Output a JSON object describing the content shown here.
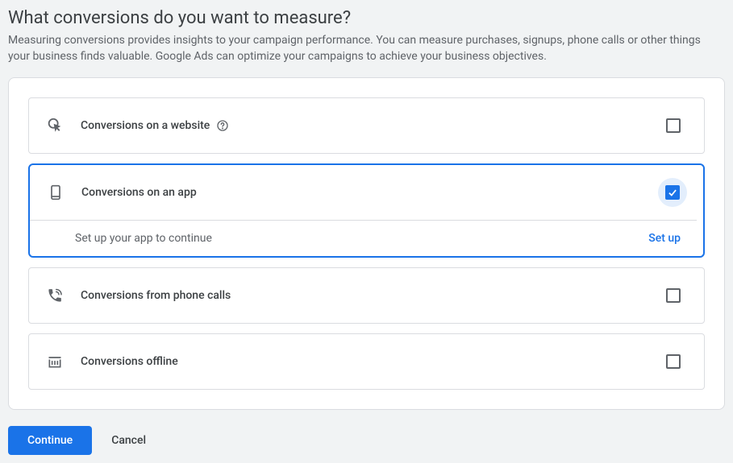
{
  "header": {
    "title": "What conversions do you want to measure?",
    "subtitle": "Measuring conversions provides insights to your campaign performance. You can measure purchases, signups, phone calls or other things your business finds valuable. Google Ads can optimize your campaigns to achieve your business objectives."
  },
  "options": {
    "website": {
      "label": "Conversions on a website"
    },
    "app": {
      "label": "Conversions on an app",
      "body": "Set up your app to continue",
      "action": "Set up"
    },
    "phone": {
      "label": "Conversions from phone calls"
    },
    "offline": {
      "label": "Conversions offline"
    }
  },
  "actions": {
    "continue": "Continue",
    "cancel": "Cancel"
  }
}
